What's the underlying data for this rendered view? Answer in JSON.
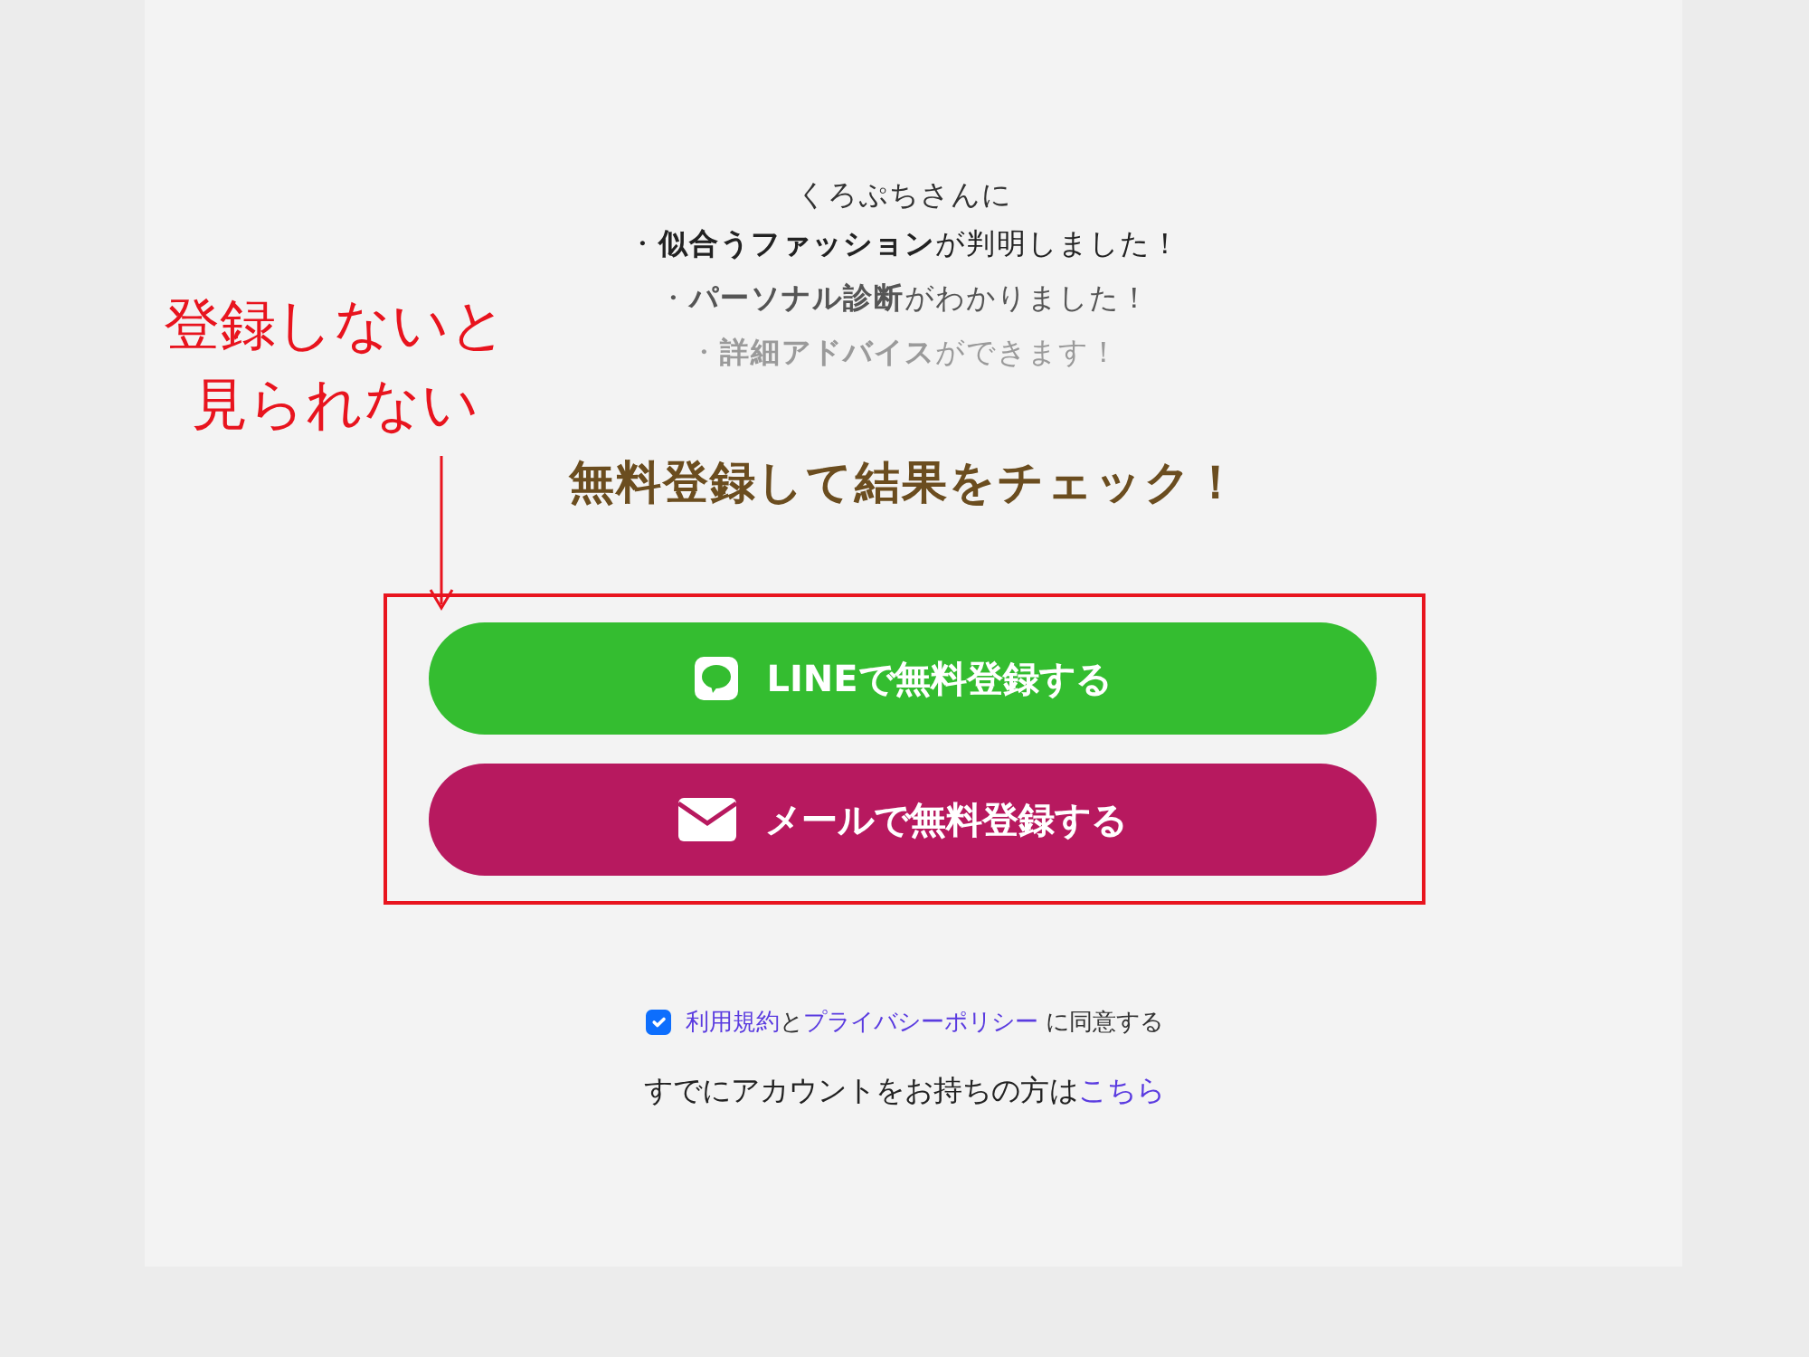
{
  "greeting": "くろぷちさんに",
  "results": [
    {
      "text": "・**似合うファッション**が判明しました！",
      "color": "#222222"
    },
    {
      "text": "・**パーソナル診断**がわかりました！",
      "color": "#555555"
    },
    {
      "text": "・**詳細アドバイス**ができます！",
      "color": "#9a9a9a"
    }
  ],
  "heading": "無料登録して結果をチェック！",
  "buttons": [
    {
      "kind": "line",
      "label": "LINEで無料登録する",
      "color": "#34bd30"
    },
    {
      "kind": "mail",
      "label": "メールで無料登録する",
      "color": "#b7195f"
    }
  ],
  "agree": {
    "checked": true,
    "parts": [
      {
        "kind": "link",
        "text": "利用規約"
      },
      {
        "kind": "text",
        "text": "と"
      },
      {
        "kind": "link",
        "text": "プライバシーポリシー"
      },
      {
        "kind": "text",
        "text": " に同意する"
      }
    ]
  },
  "login": {
    "text": "すでにアカウントをお持ちの方は",
    "link": "こちら"
  },
  "annotation": {
    "lines": [
      "登録しないと",
      "見られない"
    ]
  }
}
